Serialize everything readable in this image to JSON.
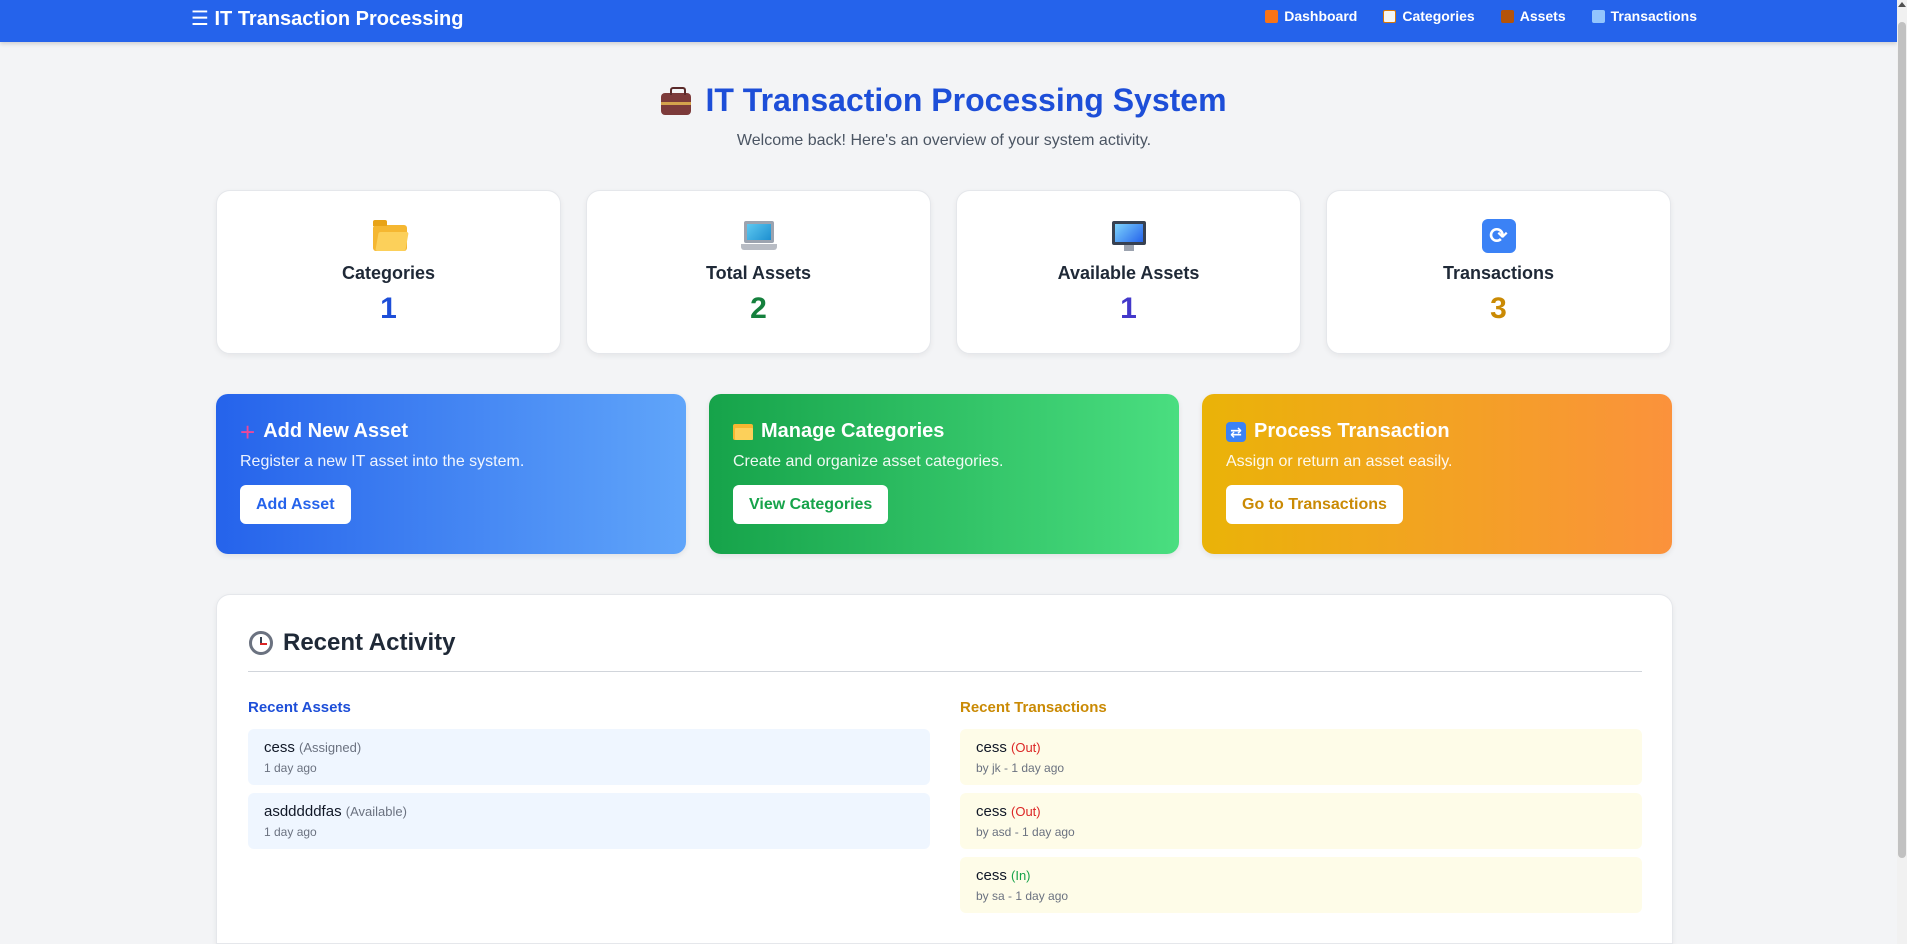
{
  "navbar": {
    "brand": "☰ IT Transaction Processing",
    "links": [
      {
        "label": "Dashboard",
        "icon": "house-icon",
        "color": "#f97316"
      },
      {
        "label": "Categories",
        "icon": "clipboard-icon",
        "color": "#f5f5f4"
      },
      {
        "label": "Assets",
        "icon": "briefcase-icon",
        "color": "#b45309"
      },
      {
        "label": "Transactions",
        "icon": "sync-icon",
        "color": "#93c5fd"
      }
    ]
  },
  "hero": {
    "title": "IT Transaction Processing System",
    "subtitle": "Welcome back! Here's an overview of your system activity."
  },
  "stats": [
    {
      "label": "Categories",
      "value": "1",
      "icon": "folder-icon",
      "color": "#1d4ed8"
    },
    {
      "label": "Total Assets",
      "value": "2",
      "icon": "laptop-icon",
      "color": "#15803d"
    },
    {
      "label": "Available Assets",
      "value": "1",
      "icon": "monitor-icon",
      "color": "#4338ca"
    },
    {
      "label": "Transactions",
      "value": "3",
      "icon": "sync-icon",
      "color": "#ca8a04"
    }
  ],
  "actions": [
    {
      "title": "Add New Asset",
      "description": "Register a new IT asset into the system.",
      "button": "Add Asset",
      "icon": "plus-icon"
    },
    {
      "title": "Manage Categories",
      "description": "Create and organize asset categories.",
      "button": "View Categories",
      "icon": "folder-icon"
    },
    {
      "title": "Process Transaction",
      "description": "Assign or return an asset easily.",
      "button": "Go to Transactions",
      "icon": "repeat-icon"
    }
  ],
  "activity": {
    "title": "Recent Activity",
    "assets_title": "Recent Assets",
    "transactions_title": "Recent Transactions",
    "assets": [
      {
        "name": "cess",
        "status": "(Assigned)",
        "meta": "1 day ago"
      },
      {
        "name": "asdddddfas",
        "status": "(Available)",
        "meta": "1 day ago"
      }
    ],
    "transactions": [
      {
        "name": "cess",
        "status": "(Out)",
        "meta": "by jk - 1 day ago"
      },
      {
        "name": "cess",
        "status": "(Out)",
        "meta": "by asd - 1 day ago"
      },
      {
        "name": "cess",
        "status": "(In)",
        "meta": "by sa - 1 day ago"
      }
    ]
  }
}
